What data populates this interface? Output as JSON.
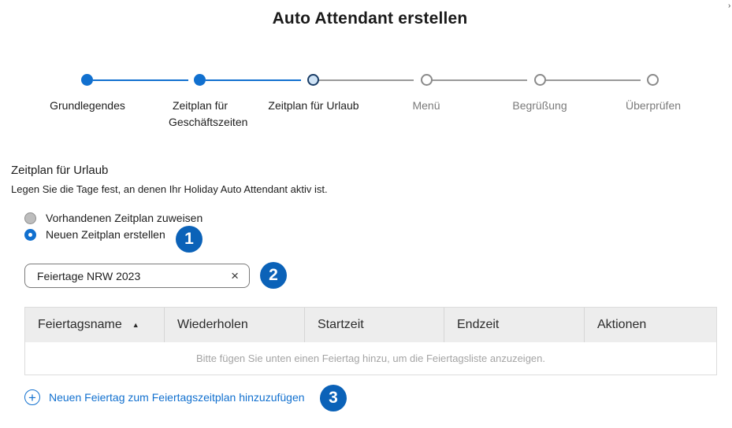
{
  "dialog": {
    "title": "Auto Attendant erstellen",
    "close_glyph": "›"
  },
  "stepper": {
    "steps": [
      {
        "label": "Grundlegendes",
        "state": "done"
      },
      {
        "label": "Zeitplan für Geschäftszeiten",
        "state": "done"
      },
      {
        "label": "Zeitplan für Urlaub",
        "state": "current"
      },
      {
        "label": "Menü",
        "state": "todo"
      },
      {
        "label": "Begrüßung",
        "state": "todo"
      },
      {
        "label": "Überprüfen",
        "state": "todo"
      }
    ]
  },
  "section": {
    "title": "Zeitplan für Urlaub",
    "description": "Legen Sie die Tage fest, an denen Ihr Holiday Auto Attendant aktiv ist."
  },
  "schedule_options": [
    {
      "label": "Vorhandenen Zeitplan zuweisen",
      "selected": false
    },
    {
      "label": "Neuen Zeitplan erstellen",
      "selected": true
    }
  ],
  "schedule_name": {
    "value": "Feiertage NRW 2023",
    "clear_glyph": "×"
  },
  "holiday_table": {
    "columns": [
      "Feiertagsname",
      "Wiederholen",
      "Startzeit",
      "Endzeit",
      "Aktionen"
    ],
    "sorted_column": "Feiertagsname",
    "sort_direction": "ascending",
    "sort_glyph": "▲",
    "empty_message": "Bitte fügen Sie unten einen Feiertag hinzu, um die Feiertagsliste anzuzeigen."
  },
  "add_holiday": {
    "label": "Neuen Feiertag zum Feiertagszeitplan hinzuzufügen",
    "icon_glyph": "+"
  },
  "callouts": [
    "1",
    "2",
    "3"
  ],
  "colors": {
    "accent": "#1170cf",
    "badge": "#0b62b8",
    "current_step_fill": "#cfe3f6",
    "inactive": "#8a8a8a"
  }
}
